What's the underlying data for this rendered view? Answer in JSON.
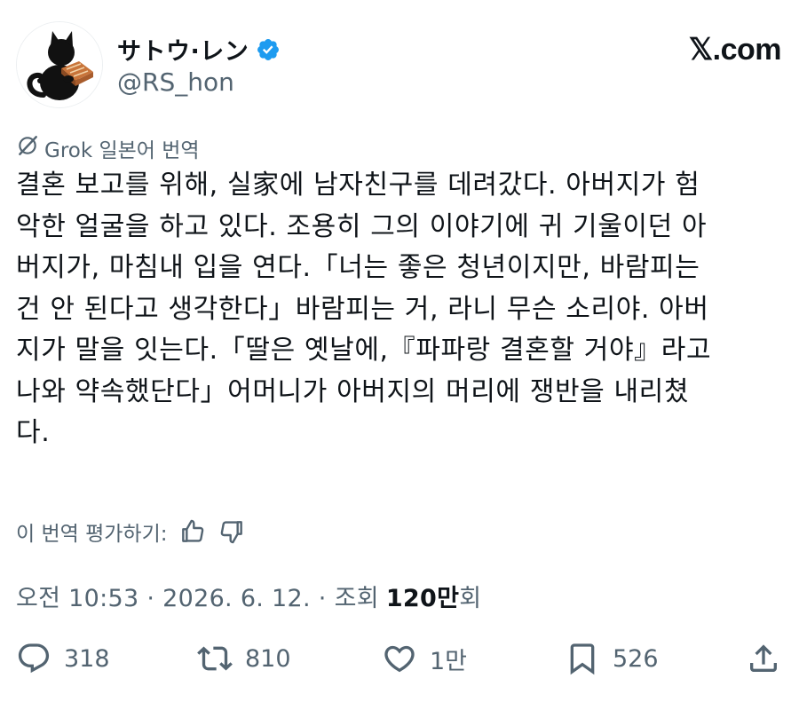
{
  "author": {
    "display_name": "サトウ·レン",
    "handle": "@RS_hon",
    "verified": true
  },
  "brand": "𝕏.com",
  "translation": {
    "label": "Grok 일본어 번역"
  },
  "tweet": {
    "lines": [
      "결혼 보고를 위해, 실家에 남자친구를 데려갔다. 아버지가 험",
      "악한 얼굴을 하고 있다. 조용히 그의 이야기에 귀 기울이던 아",
      "버지가, 마침내 입을 연다.「너는 좋은 청년이지만, 바람피는",
      "건 안 된다고 생각한다」바람피는 거, 라니 무슨 소리야. 아버",
      "지가 말을 잇는다.「딸은 옛날에,『파파랑 결혼할 거야』라고",
      "나와 약속했단다」어머니가 아버지의 머리에 쟁반을 내리쳤",
      "다."
    ]
  },
  "rating": {
    "label": "이 번역 평가하기:"
  },
  "meta": {
    "time": "오전 10:53",
    "date": "2026. 6. 12.",
    "views_prefix": "조회",
    "views_count": "120만",
    "views_suffix": "회"
  },
  "actions": {
    "replies": "318",
    "reposts": "810",
    "likes": "1만",
    "bookmarks": "526"
  },
  "colors": {
    "text": "#0f1419",
    "secondary": "#536471",
    "verified": "#1d9bf0"
  }
}
